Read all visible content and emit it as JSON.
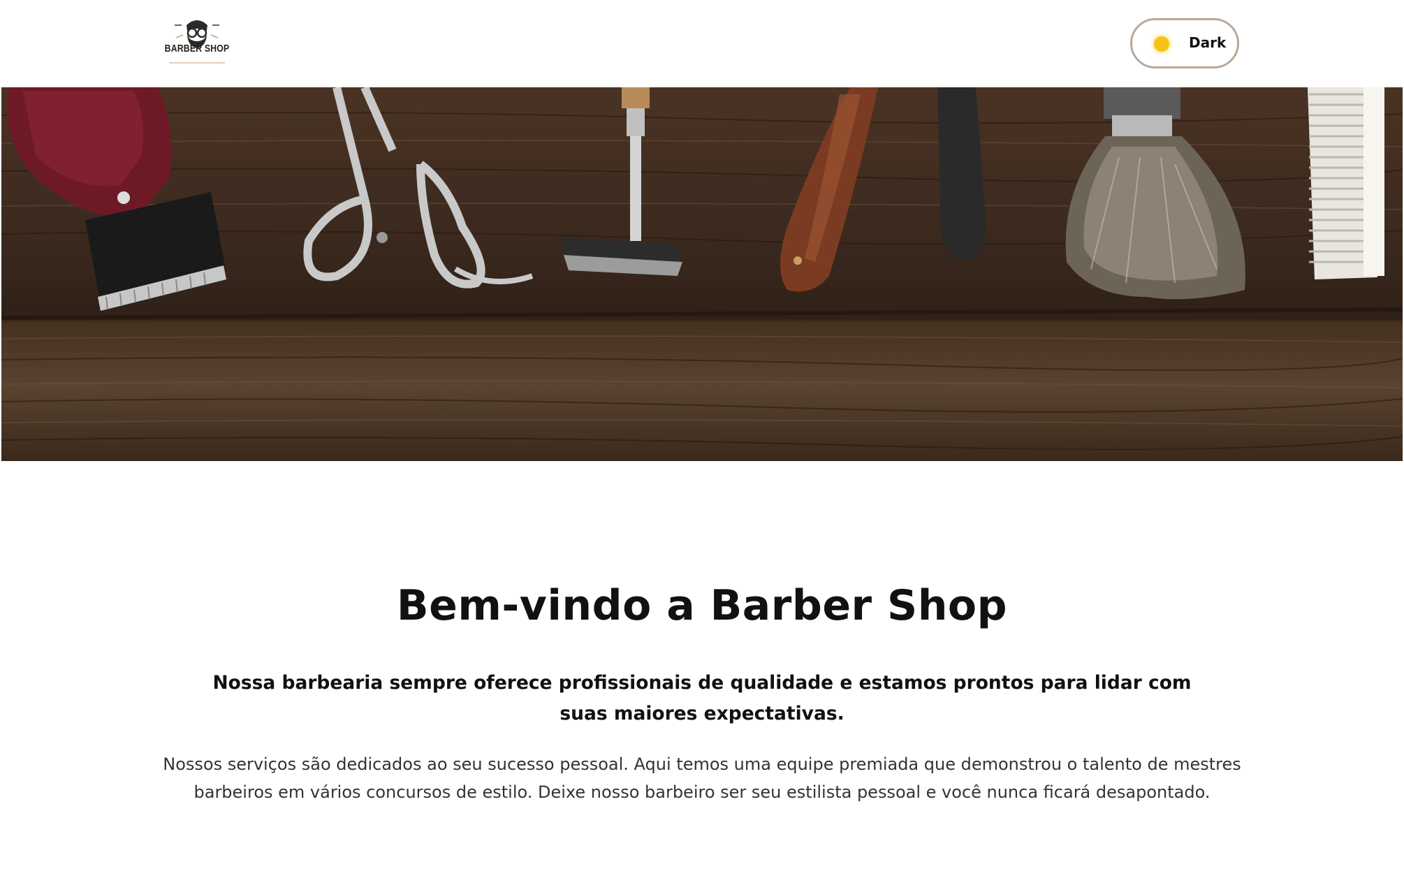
{
  "header": {
    "logo_text": "BARBER SHOP",
    "theme_toggle": {
      "label": "Dark",
      "icon": "sun-icon"
    }
  },
  "hero": {
    "image": "barber-tools-on-wooden-table",
    "tools": [
      "hair-clipper",
      "scissors",
      "safety-razor",
      "straight-razor",
      "shaving-brush",
      "comb"
    ]
  },
  "main": {
    "title": "Bem-vindo a Barber Shop",
    "lead": "Nossa barbearia sempre oferece profissionais de qualidade e estamos prontos para lidar com suas maiores expectativas.",
    "body": "Nossos serviços são dedicados ao seu sucesso pessoal. Aqui temos uma equipe premiada que demonstrou o talento de mestres barbeiros em vários concursos de estilo. Deixe nosso barbeiro ser seu estilista pessoal e você nunca ficará desapontado."
  },
  "colors": {
    "accent_sun": "#f6c417",
    "toggle_border": "#b9a89a",
    "text": "#111111"
  }
}
